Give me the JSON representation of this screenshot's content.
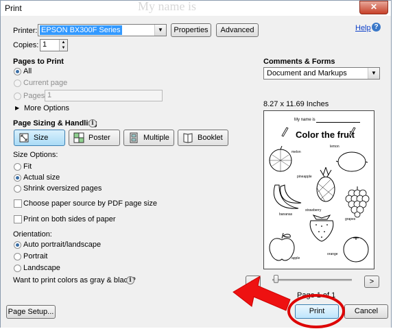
{
  "window": {
    "title": "Print",
    "close_glyph": "✕",
    "watermark_text": "My name is"
  },
  "printer": {
    "label": "Printer:",
    "value": "EPSON BX300F Series",
    "properties_label": "Properties",
    "advanced_label": "Advanced"
  },
  "help": {
    "label": "Help"
  },
  "copies": {
    "label": "Copies:",
    "value": "1"
  },
  "pages": {
    "heading": "Pages to Print",
    "all": "All",
    "current": "Current page",
    "pages_label": "Pages",
    "pages_value": "1",
    "more_options": "More Options"
  },
  "sizing": {
    "heading": "Page Sizing & Handling",
    "buttons": [
      "Size",
      "Poster",
      "Multiple",
      "Booklet"
    ],
    "size_options_label": "Size Options:",
    "fit": "Fit",
    "actual": "Actual size",
    "shrink": "Shrink oversized pages",
    "choose_source": "Choose paper source by PDF page size",
    "both_sides": "Print on both sides of paper"
  },
  "orientation": {
    "label": "Orientation:",
    "auto": "Auto portrait/landscape",
    "portrait": "Portrait",
    "landscape": "Landscape"
  },
  "gray_text": "Want to print colors as gray & black?",
  "comments": {
    "heading": "Comments & Forms",
    "value": "Document and Markups"
  },
  "preview": {
    "size_text": "8.27 x 11.69 Inches",
    "name_line": "My name is",
    "title": "Color the fruit",
    "fruit_labels": [
      "melon",
      "lemon",
      "pineapple",
      "bananas",
      "grapes",
      "strawberry",
      "apple",
      "orange"
    ],
    "page_indicator": "Page 1 of 1"
  },
  "nav": {
    "prev_glyph": "<",
    "next_glyph": ">"
  },
  "buttons": {
    "page_setup": "Page Setup...",
    "print": "Print",
    "cancel": "Cancel"
  },
  "annotation": {
    "arrow_color": "#ee1111",
    "circle_color": "#dd0000"
  },
  "colors": {
    "selection": "#3399ff",
    "link": "#0b3ec8"
  }
}
